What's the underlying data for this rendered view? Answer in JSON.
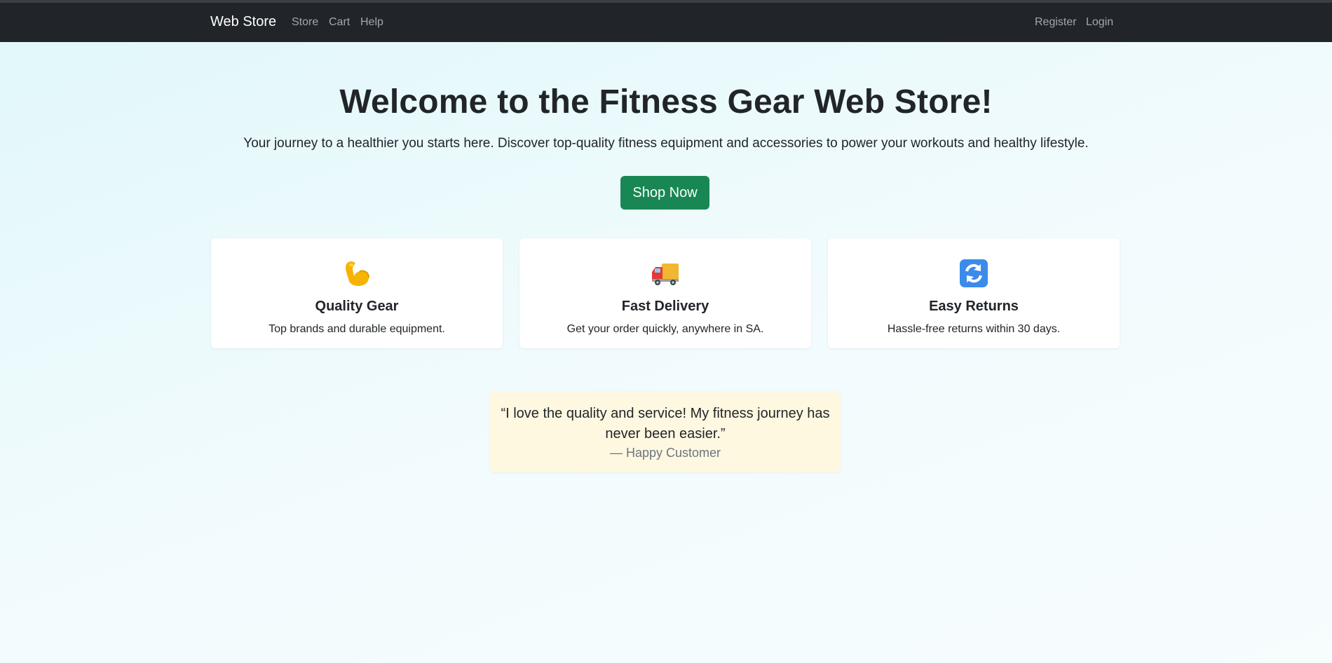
{
  "navbar": {
    "brand": "Web Store",
    "links": [
      "Store",
      "Cart",
      "Help"
    ],
    "right_links": [
      "Register",
      "Login"
    ]
  },
  "hero": {
    "title": "Welcome to the Fitness Gear Web Store!",
    "subtitle": "Your journey to a healthier you starts here. Discover top-quality fitness equipment and accessories to power your workouts and healthy lifestyle.",
    "cta_label": "Shop Now"
  },
  "features": [
    {
      "icon": "flexed-biceps-icon",
      "title": "Quality Gear",
      "text": "Top brands and durable equipment."
    },
    {
      "icon": "delivery-truck-icon",
      "title": "Fast Delivery",
      "text": "Get your order quickly, anywhere in SA."
    },
    {
      "icon": "refresh-arrows-icon",
      "title": "Easy Returns",
      "text": "Hassle-free returns within 30 days."
    }
  ],
  "testimonial": {
    "quote": "“I love the quality and service! My fitness journey has never been easier.”",
    "author": "— Happy Customer"
  },
  "colors": {
    "navbar_bg": "#212529",
    "cta_bg": "#198754",
    "quote_bg": "#fff8e1",
    "page_bg": "#e0f7fa"
  }
}
